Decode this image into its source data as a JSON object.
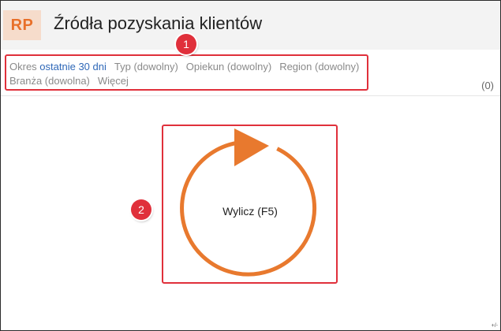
{
  "header": {
    "logo_text": "RP",
    "title": "Źródła pozyskania klientów"
  },
  "filters": {
    "items": [
      {
        "label": "Okres",
        "value": "ostatnie 30 dni"
      },
      {
        "label": "Typ (dowolny)"
      },
      {
        "label": "Opiekun (dowolny)"
      },
      {
        "label": "Region (dowolny)"
      },
      {
        "label": "Branża (dowolna)"
      },
      {
        "label": "Więcej"
      }
    ],
    "count": "(0)"
  },
  "compute": {
    "label": "Wylicz (F5)",
    "icon": "refresh-icon",
    "color": "#e8792e"
  },
  "callouts": {
    "badge1": "1",
    "badge2": "2",
    "color": "#e0303b"
  },
  "corner_mark": "+/-"
}
